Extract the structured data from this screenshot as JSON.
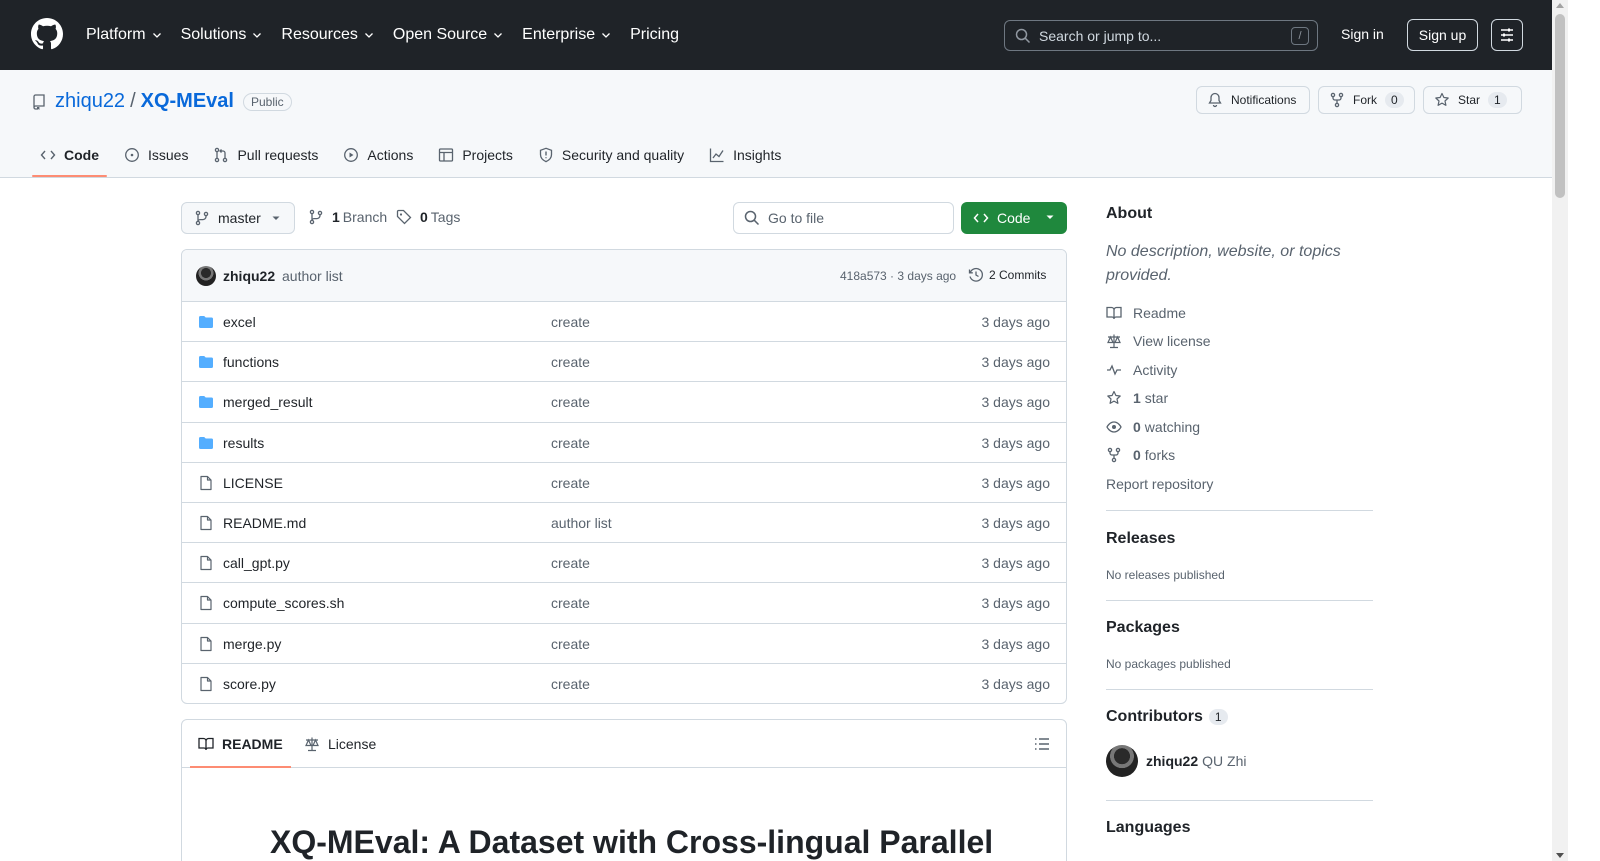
{
  "header": {
    "nav": [
      "Platform",
      "Solutions",
      "Resources",
      "Open Source",
      "Enterprise",
      "Pricing"
    ],
    "search_placeholder": "Search or jump to...",
    "search_kbd": "/",
    "signin": "Sign in",
    "signup": "Sign up"
  },
  "repo": {
    "owner": "zhiqu22",
    "sep": "/",
    "name": "XQ-MEval",
    "visibility": "Public",
    "notifications": "Notifications",
    "fork_label": "Fork",
    "fork_count": "0",
    "star_label": "Star",
    "star_count": "1"
  },
  "tabs": [
    "Code",
    "Issues",
    "Pull requests",
    "Actions",
    "Projects",
    "Security and quality",
    "Insights"
  ],
  "toolbar": {
    "branch": "master",
    "branch_count": "1",
    "branch_label": "Branch",
    "tag_count": "0",
    "tag_label": "Tags",
    "goto_placeholder": "Go to file",
    "code_label": "Code"
  },
  "commit": {
    "author": "zhiqu22",
    "message": "author list",
    "sha_time": "418a573 · 3 days ago",
    "commits": "2 Commits"
  },
  "files": [
    {
      "type": "folder",
      "name": "excel",
      "message": "create",
      "date": "3 days ago"
    },
    {
      "type": "folder",
      "name": "functions",
      "message": "create",
      "date": "3 days ago"
    },
    {
      "type": "folder",
      "name": "merged_result",
      "message": "create",
      "date": "3 days ago"
    },
    {
      "type": "folder",
      "name": "results",
      "message": "create",
      "date": "3 days ago"
    },
    {
      "type": "file",
      "name": "LICENSE",
      "message": "create",
      "date": "3 days ago"
    },
    {
      "type": "file",
      "name": "README.md",
      "message": "author list",
      "date": "3 days ago"
    },
    {
      "type": "file",
      "name": "call_gpt.py",
      "message": "create",
      "date": "3 days ago"
    },
    {
      "type": "file",
      "name": "compute_scores.sh",
      "message": "create",
      "date": "3 days ago"
    },
    {
      "type": "file",
      "name": "merge.py",
      "message": "create",
      "date": "3 days ago"
    },
    {
      "type": "file",
      "name": "score.py",
      "message": "create",
      "date": "3 days ago"
    }
  ],
  "readme": {
    "tab_readme": "README",
    "tab_license": "License",
    "title": "XQ-MEval: A Dataset with Cross-lingual Parallel"
  },
  "sidebar": {
    "about_title": "About",
    "description": "No description, website, or topics provided.",
    "links": {
      "readme": "Readme",
      "license": "View license",
      "activity": "Activity",
      "stars_count": "1",
      "stars_label": "star",
      "watching_count": "0",
      "watching_label": "watching",
      "forks_count": "0",
      "forks_label": "forks",
      "report": "Report repository"
    },
    "releases_title": "Releases",
    "releases_text": "No releases published",
    "packages_title": "Packages",
    "packages_text": "No packages published",
    "contributors_title": "Contributors",
    "contributors_count": "1",
    "contributor_login": "zhiqu22",
    "contributor_name": "QU Zhi",
    "languages_title": "Languages"
  },
  "colors": {
    "header_bg": "#1f2328",
    "link": "#0969da",
    "code_button": "#1f883d",
    "tab_underline": "#fd8c73",
    "folder": "#54aeff"
  }
}
